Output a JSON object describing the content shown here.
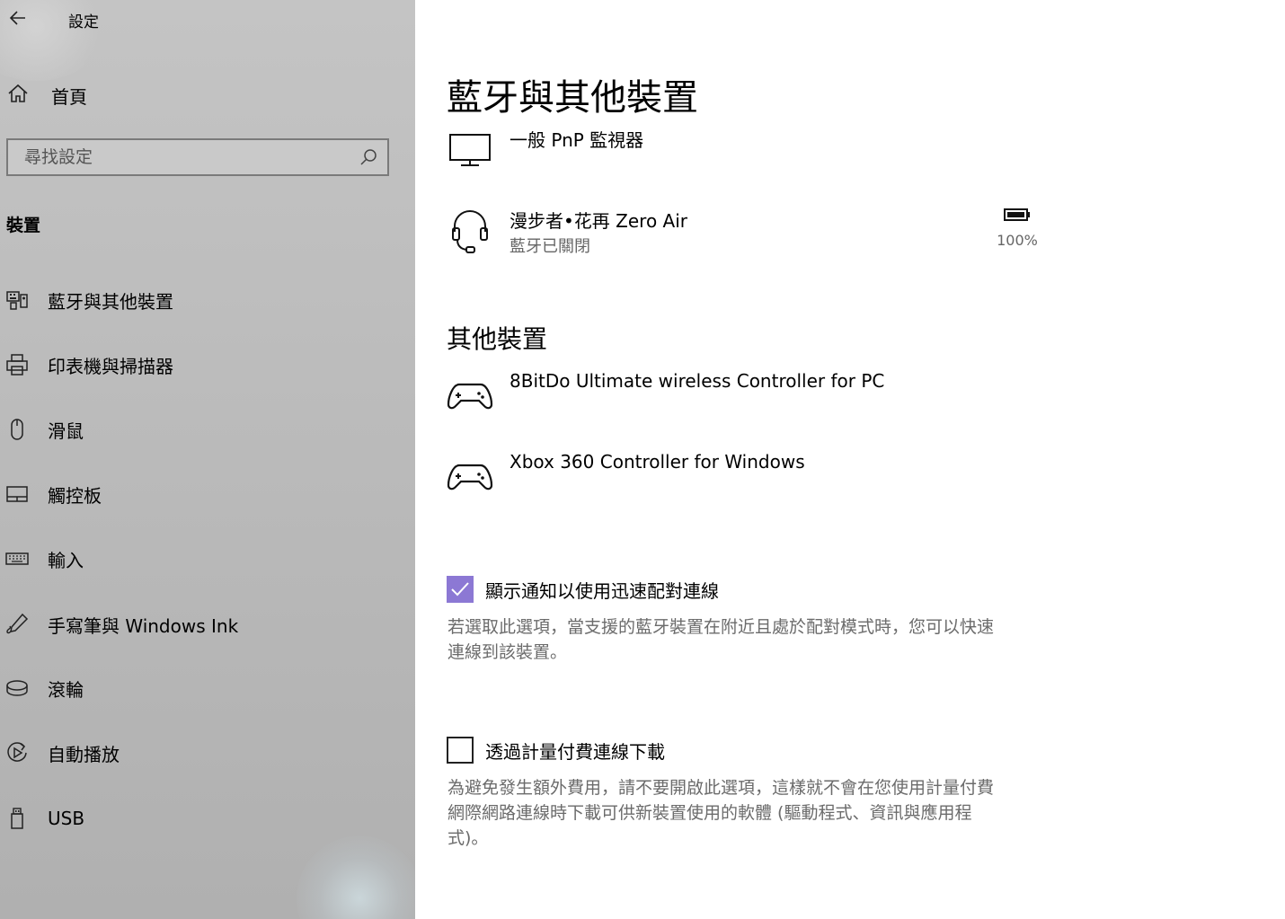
{
  "app": {
    "title": "設定"
  },
  "sidebar": {
    "home_label": "首頁",
    "search_placeholder": "尋找設定",
    "section_title": "裝置",
    "items": [
      {
        "label": "藍牙與其他裝置",
        "icon": "bluetooth-devices-icon"
      },
      {
        "label": "印表機與掃描器",
        "icon": "printer-icon"
      },
      {
        "label": "滑鼠",
        "icon": "mouse-icon"
      },
      {
        "label": "觸控板",
        "icon": "touchpad-icon"
      },
      {
        "label": "輸入",
        "icon": "keyboard-icon"
      },
      {
        "label": "手寫筆與 Windows Ink",
        "icon": "pen-icon"
      },
      {
        "label": "滾輪",
        "icon": "dial-icon"
      },
      {
        "label": "自動播放",
        "icon": "autoplay-icon"
      },
      {
        "label": "USB",
        "icon": "usb-icon"
      }
    ]
  },
  "main": {
    "title": "藍牙與其他裝置",
    "devices": [
      {
        "name": "一般 PnP 監視器",
        "icon": "monitor-icon"
      },
      {
        "name": "漫步者•花再 Zero Air",
        "status": "藍牙已關閉",
        "battery": "100%",
        "icon": "headset-icon"
      }
    ],
    "other_heading": "其他裝置",
    "other_devices": [
      {
        "name": "8BitDo Ultimate wireless Controller for PC",
        "icon": "gamepad-icon"
      },
      {
        "name": "Xbox 360 Controller for Windows",
        "icon": "gamepad-icon"
      }
    ],
    "swift_pair": {
      "label": "顯示通知以使用迅速配對連線",
      "checked": true,
      "desc_line1": "若選取此選項，當支援的藍牙裝置在附近且處於配對模式時，您可以快速",
      "desc_line2": "連線到該裝置。"
    },
    "metered": {
      "label": "透過計量付費連線下載",
      "checked": false,
      "desc_line1": "為避免發生額外費用，請不要開啟此選項，這樣就不會在您使用計量付費",
      "desc_line2": "網際網路連線時下載可供新裝置使用的軟體 (驅動程式、資訊與應用程",
      "desc_line3": "式)。"
    }
  },
  "colors": {
    "accent": "#8c78d4",
    "sidebar_bg": "#bdbdbd",
    "secondary_text": "#6b6b6b"
  }
}
